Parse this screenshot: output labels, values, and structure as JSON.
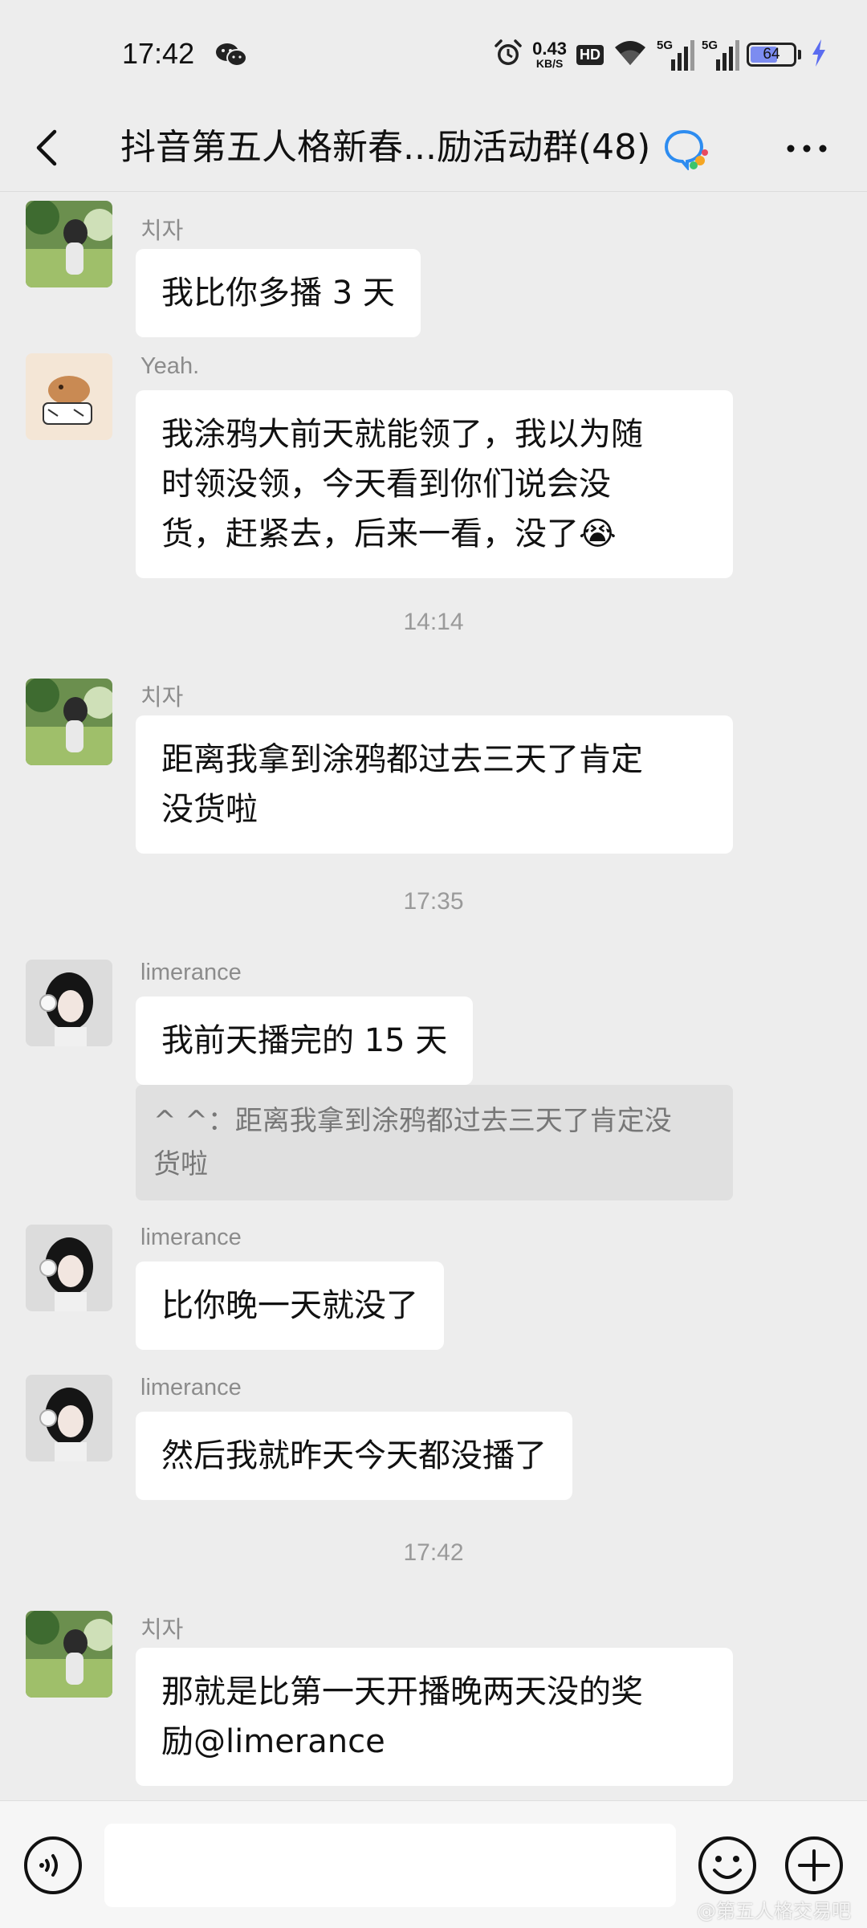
{
  "status_bar": {
    "time": "17:42",
    "net_speed_value": "0.43",
    "net_speed_unit": "KB/S",
    "hd_label": "HD",
    "signal_1_label": "5G",
    "signal_2_label": "5G",
    "battery_level": "64",
    "battery_fraction": 0.64,
    "icons": [
      "wechat-icon",
      "alarm-icon",
      "wifi-icon",
      "charging-icon"
    ]
  },
  "header": {
    "title": "抖音第五人格新春...励活动群(48)",
    "back_icon": "chevron-left-icon",
    "group_icon": "group-chat-icon",
    "more_icon": "more-dots-icon"
  },
  "messages": [
    {
      "type": "message",
      "sender": "치자",
      "text": "我比你多播 3 天"
    },
    {
      "type": "message",
      "sender": "Yeah.",
      "lines": [
        "我涂鸦大前天就能领了，我以为随",
        "时领没领，今天看到你们说会没",
        "货，赶紧去，后来一看，没了"
      ],
      "emoji": "😭"
    },
    {
      "type": "time",
      "text": "14:14"
    },
    {
      "type": "message",
      "sender": "치자",
      "lines": [
        "距离我拿到涂鸦都过去三天了肯定",
        "没货啦"
      ]
    },
    {
      "type": "time",
      "text": "17:35"
    },
    {
      "type": "message",
      "sender": "limerance",
      "text": "我前天播完的 15 天",
      "quote_lines": [
        "^ ^：距离我拿到涂鸦都过去三天了肯定没",
        "货啦"
      ]
    },
    {
      "type": "message",
      "sender": "limerance",
      "text": "比你晚一天就没了"
    },
    {
      "type": "message",
      "sender": "limerance",
      "text": "然后我就昨天今天都没播了"
    },
    {
      "type": "time",
      "text": "17:42"
    },
    {
      "type": "message",
      "sender": "치자",
      "lines": [
        "那就是比第一天开播晚两天没的奖",
        "励@limerance"
      ]
    }
  ],
  "input_bar": {
    "placeholder": "",
    "voice_icon": "voice-icon",
    "emoji_icon": "emoji-icon",
    "plus_icon": "plus-icon"
  },
  "watermark": "@第五人格交易吧",
  "colors": {
    "background": "#ededed",
    "bubble": "#ffffff",
    "quote": "#e0e0e0",
    "sender": "#8c8c8c",
    "timestamp": "#9a9a9a",
    "battery_fill": "#7c8cf0"
  }
}
